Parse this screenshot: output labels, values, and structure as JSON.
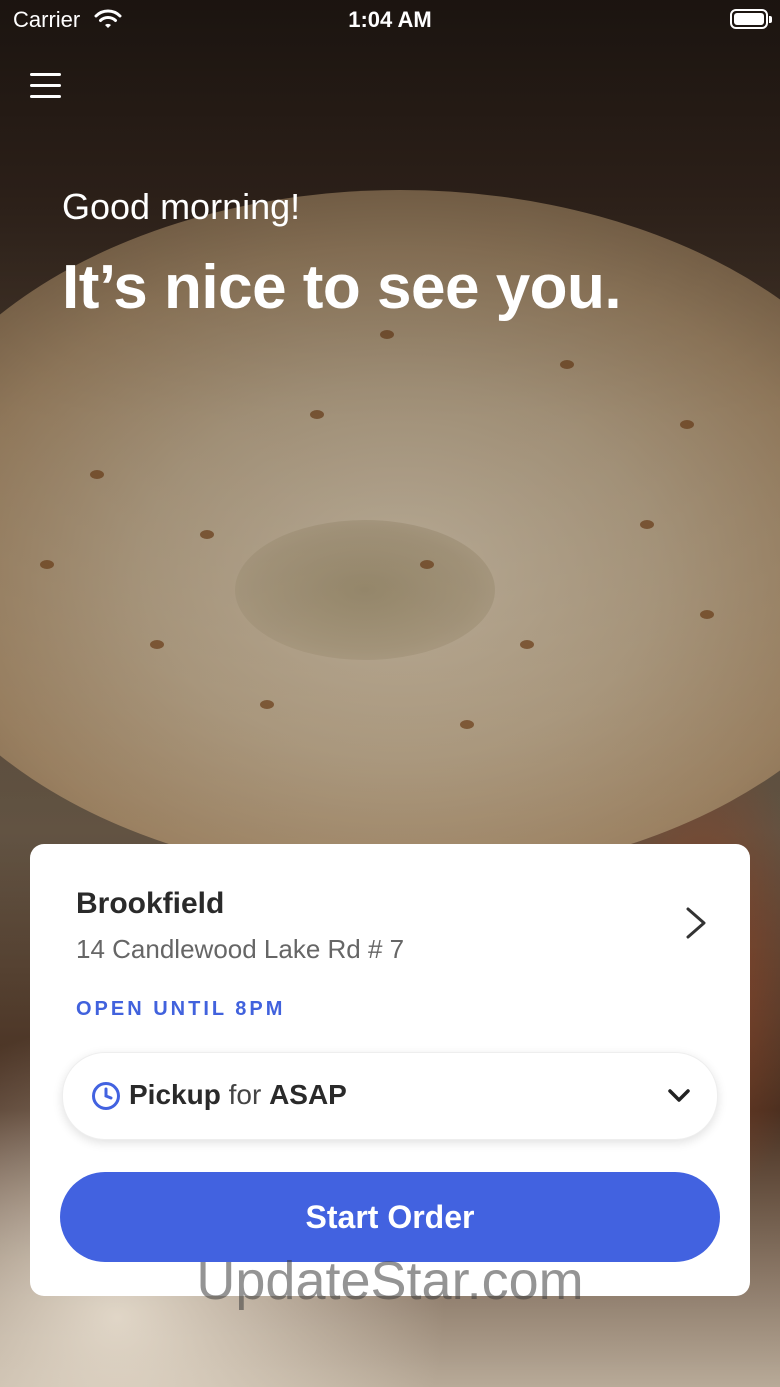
{
  "status_bar": {
    "carrier": "Carrier",
    "time": "1:04 AM"
  },
  "hero": {
    "greeting": "Good morning!",
    "headline": "It’s nice to see you."
  },
  "location": {
    "name": "Brookfield",
    "address": "14 Candlewood Lake Rd # 7",
    "hours": "OPEN UNTIL 8PM"
  },
  "order_mode": {
    "mode": "Pickup",
    "connector": "for",
    "time": "ASAP"
  },
  "start_button": "Start Order",
  "watermark": "UpdateStar.com",
  "colors": {
    "accent": "#4262e0",
    "hours": "#4162dd"
  },
  "icons": [
    "wifi-icon",
    "battery-icon",
    "menu-icon",
    "chevron-right-icon",
    "clock-icon",
    "chevron-down-icon"
  ]
}
